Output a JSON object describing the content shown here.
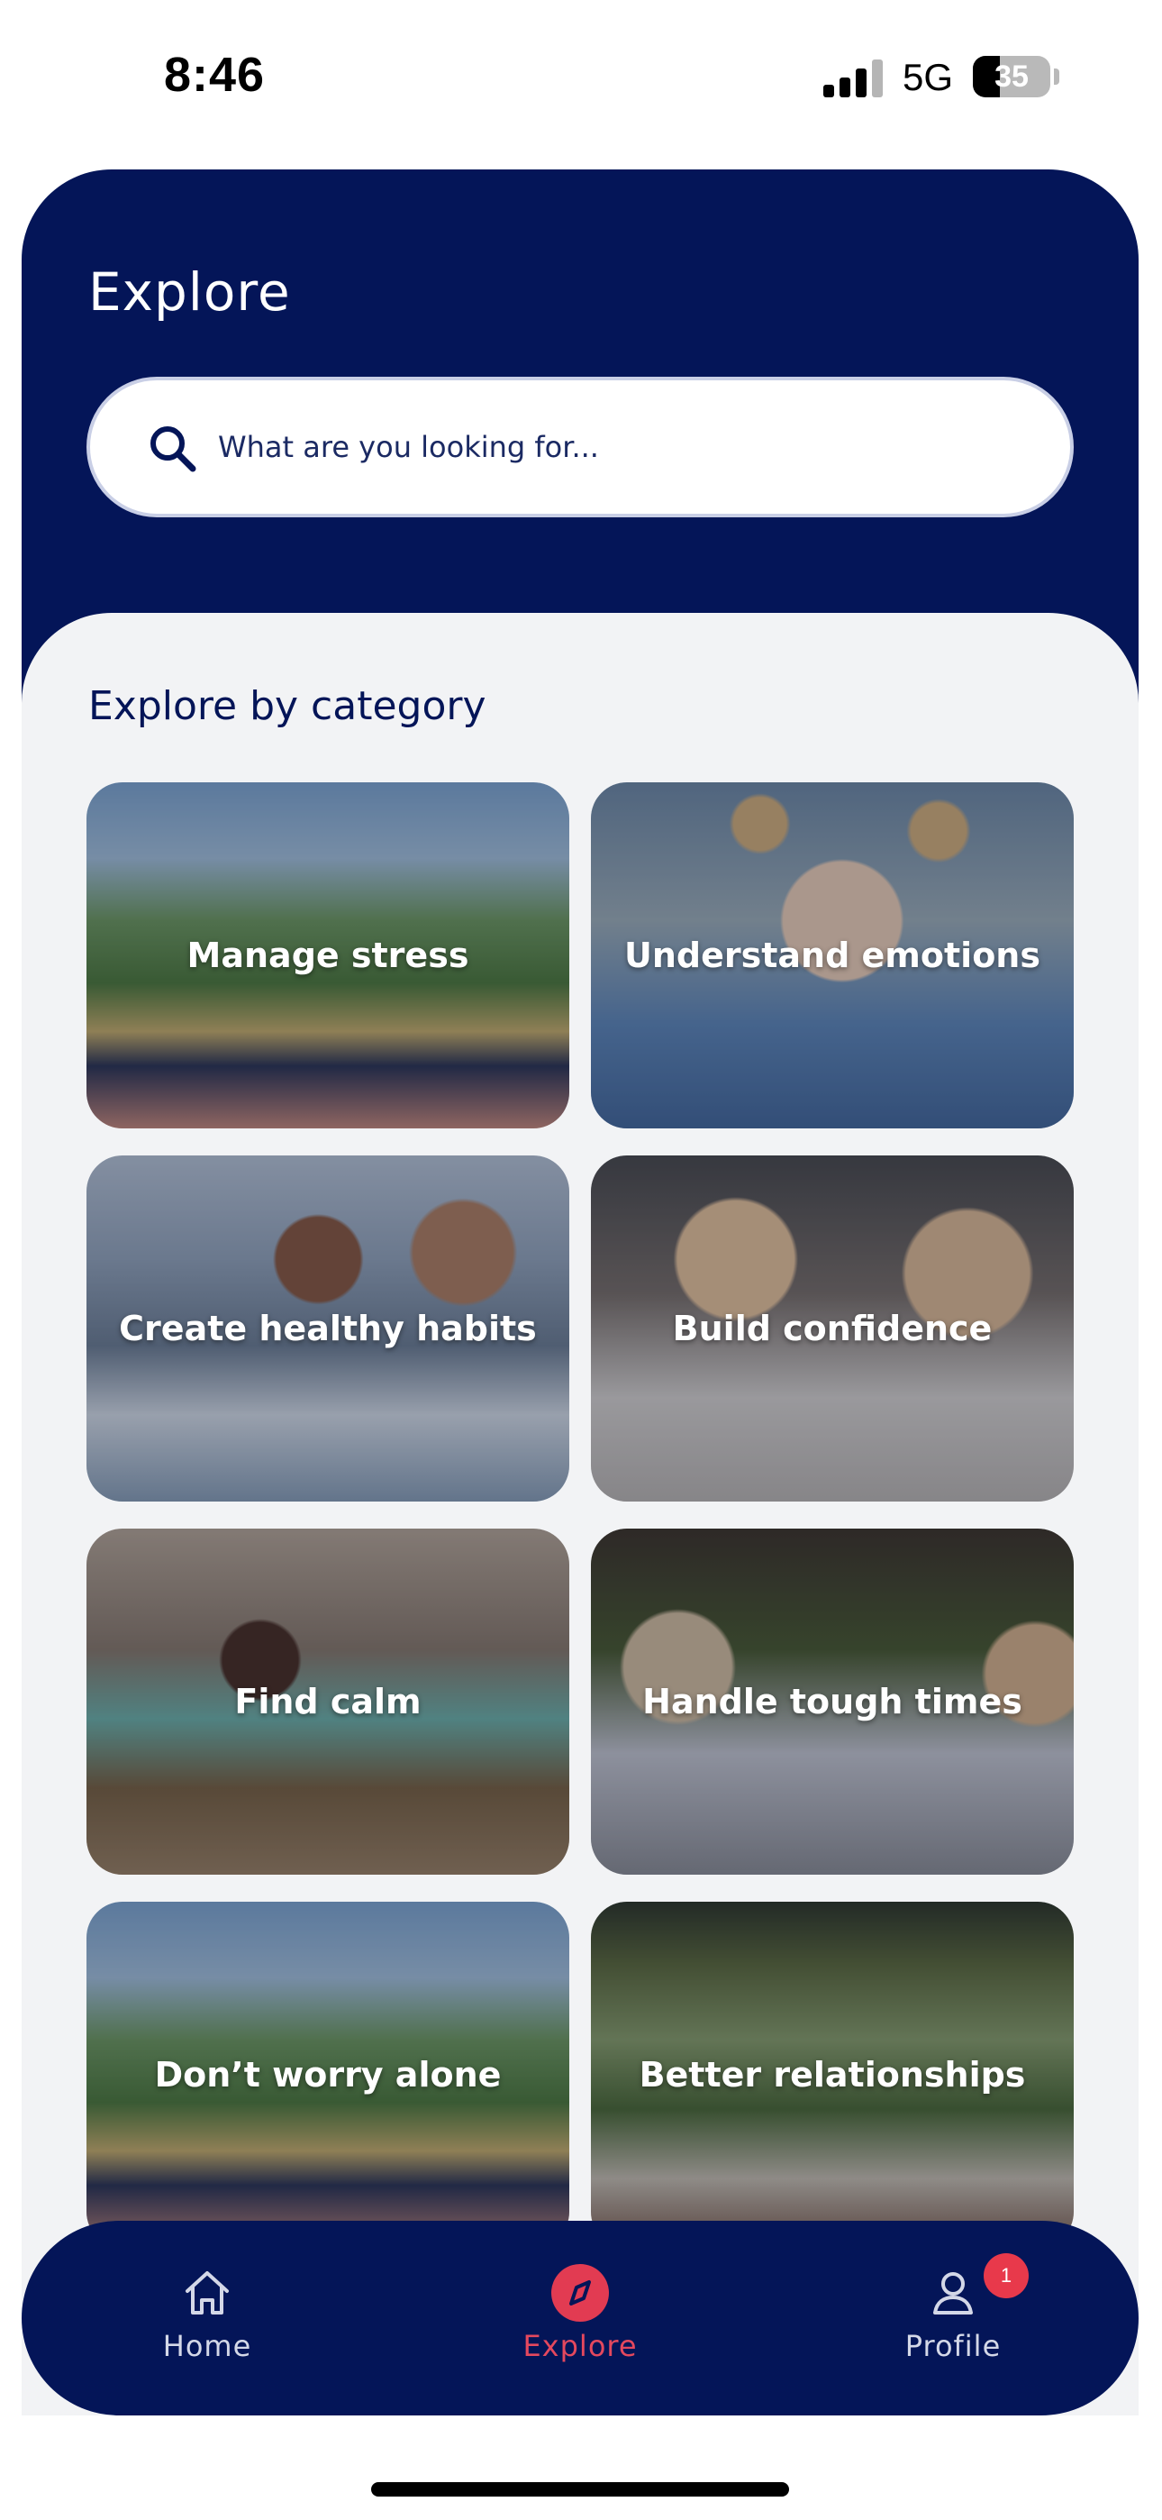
{
  "status_bar": {
    "time": "8:46",
    "network": "5G",
    "battery_percent": 35,
    "battery_text": "35"
  },
  "header": {
    "title": "Explore"
  },
  "search": {
    "placeholder": "What are you looking for..."
  },
  "section": {
    "title": "Explore by category"
  },
  "categories": [
    {
      "label": "Manage stress"
    },
    {
      "label": "Understand emotions"
    },
    {
      "label": "Create healthy habits"
    },
    {
      "label": "Build confidence"
    },
    {
      "label": "Find calm"
    },
    {
      "label": "Handle tough times"
    },
    {
      "label": "Don’t worry alone"
    },
    {
      "label": "Better relationships"
    }
  ],
  "bottom_nav": {
    "items": [
      {
        "label": "Home",
        "icon": "home-icon"
      },
      {
        "label": "Explore",
        "icon": "compass-icon",
        "active": true
      },
      {
        "label": "Profile",
        "icon": "user-icon",
        "badge": "1"
      }
    ]
  },
  "colors": {
    "navy": "#041558",
    "accent": "#e23b52",
    "background": "#f2f3f5"
  }
}
